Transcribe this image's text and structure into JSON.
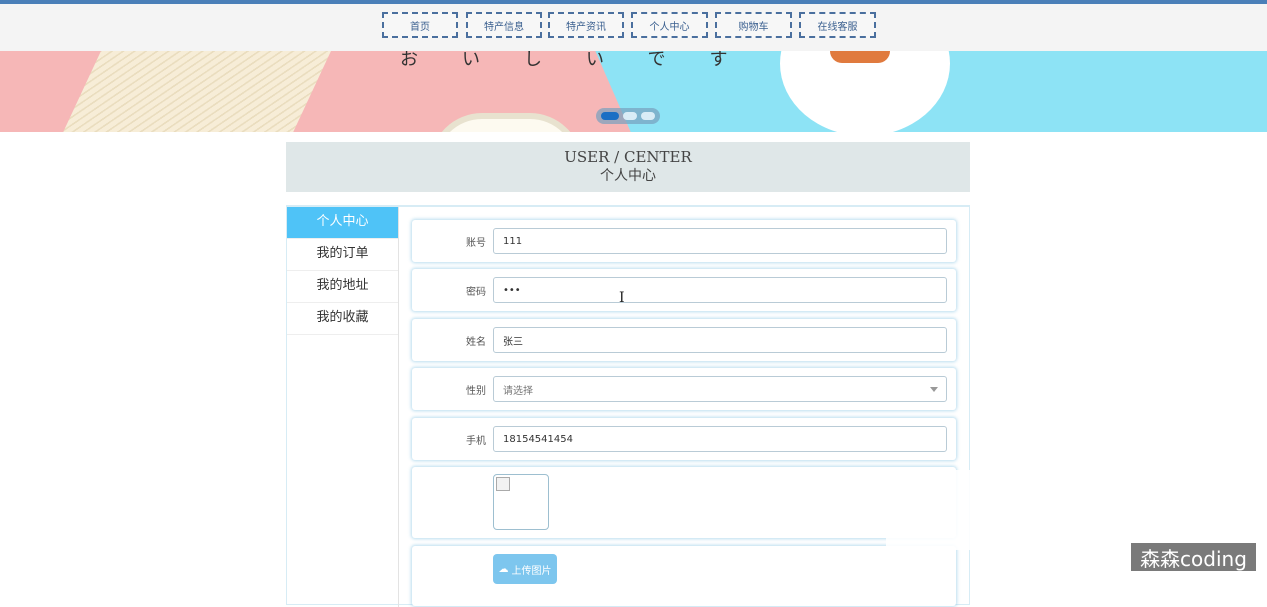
{
  "nav": {
    "items": [
      {
        "label": "首页"
      },
      {
        "label": "特产信息"
      },
      {
        "label": "特产资讯"
      },
      {
        "label": "个人中心"
      },
      {
        "label": "购物车"
      },
      {
        "label": "在线客服"
      }
    ]
  },
  "banner": {
    "japanese_text": "おいしいです",
    "active_slide": 1,
    "slide_count": 3
  },
  "header": {
    "title_en": "USER / CENTER",
    "title_cn": "个人中心"
  },
  "sidebar": {
    "items": [
      {
        "label": "个人中心",
        "active": true
      },
      {
        "label": "我的订单"
      },
      {
        "label": "我的地址"
      },
      {
        "label": "我的收藏"
      }
    ]
  },
  "form": {
    "account": {
      "label": "账号",
      "value": "111"
    },
    "password": {
      "label": "密码",
      "value": "•••"
    },
    "name": {
      "label": "姓名",
      "value": "张三"
    },
    "gender": {
      "label": "性别",
      "value": "请选择"
    },
    "phone": {
      "label": "手机",
      "value": "18154541454"
    },
    "upload": {
      "label": "上传图片"
    }
  },
  "watermark": "森森coding",
  "colors": {
    "accent": "#4fc3f7",
    "nav_border": "#4a6f9e",
    "banner_pink": "#f6b7b7",
    "banner_blue": "#8de3f5"
  }
}
